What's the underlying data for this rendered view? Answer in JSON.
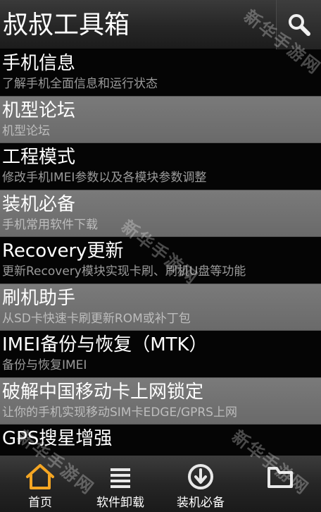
{
  "header": {
    "title": "叔叔工具箱",
    "search_icon": "search-icon"
  },
  "list": {
    "items": [
      {
        "title": "手机信息",
        "desc": "了解手机全面信息和运行状态"
      },
      {
        "title": "机型论坛",
        "desc": "机型论坛"
      },
      {
        "title": "工程模式",
        "desc": "修改手机IMEI参数以及各模块参数调整"
      },
      {
        "title": "装机必备",
        "desc": "手机常用软件下载"
      },
      {
        "title": "Recovery更新",
        "desc": "更新Recovery模块实现卡刷、刷机U盘等功能"
      },
      {
        "title": "刷机助手",
        "desc": "从SD卡快速卡刷更新ROM或补丁包"
      },
      {
        "title": "IMEI备份与恢复（MTK）",
        "desc": "备份与恢复IMEI"
      },
      {
        "title": "破解中国移动卡上网锁定",
        "desc": "让你的手机实现移动SIM卡EDGE/GPRS上网"
      },
      {
        "title": "GPS搜星增强",
        "desc": ""
      }
    ]
  },
  "tabbar": {
    "tabs": [
      {
        "label": "首页",
        "icon": "home-icon"
      },
      {
        "label": "软件卸载",
        "icon": "list-icon"
      },
      {
        "label": "装机必备",
        "icon": "download-icon"
      },
      {
        "label": "",
        "icon": "folder-icon"
      }
    ]
  },
  "watermark": {
    "text": "新华手游网"
  },
  "colors": {
    "accent": "#f5a623",
    "alt_row": "#707070",
    "dark_row": "#050505"
  }
}
